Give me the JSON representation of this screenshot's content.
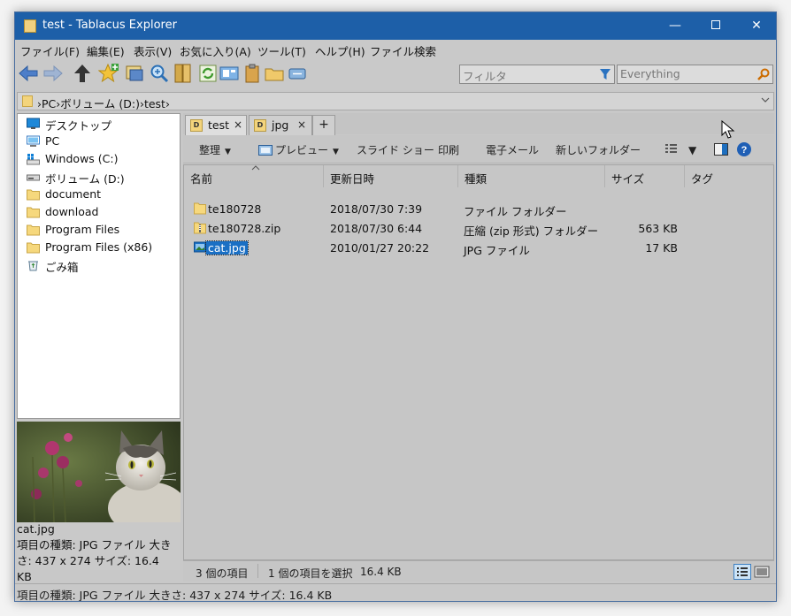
{
  "window": {
    "title": "test - Tablacus Explorer",
    "controls": {
      "minimize": "—",
      "close": "✕"
    }
  },
  "menu": [
    "ファイル(F)",
    "編集(E)",
    "表示(V)",
    "お気に入り(A)",
    "ツール(T)",
    "ヘルプ(H)",
    "ファイル検索"
  ],
  "toolbar": {
    "icons": [
      "back-arrow",
      "forward-arrow",
      "up-arrow",
      "add-favorite",
      "new-window",
      "search",
      "folder-tree",
      "refresh",
      "view",
      "paste",
      "new-folder",
      "properties"
    ],
    "filter_placeholder": "フィルタ",
    "everything_placeholder": "Everything"
  },
  "address": {
    "path": "›PC›ボリューム (D:)›test›"
  },
  "tree": [
    {
      "label": "デスクトップ",
      "icon": "desktop-icon"
    },
    {
      "label": "PC",
      "icon": "pc-icon"
    },
    {
      "label": "Windows (C:)",
      "icon": "windows-drive-icon"
    },
    {
      "label": "ボリューム (D:)",
      "icon": "drive-icon"
    },
    {
      "label": "document",
      "icon": "folder-icon"
    },
    {
      "label": "download",
      "icon": "folder-icon"
    },
    {
      "label": "Program Files",
      "icon": "folder-icon"
    },
    {
      "label": "Program Files (x86)",
      "icon": "folder-icon"
    },
    {
      "label": "ごみ箱",
      "icon": "recycle-bin-icon"
    }
  ],
  "preview": {
    "filename": "cat.jpg",
    "info": "項目の種類: JPG ファイル 大きさ: 437 x 274 サイズ: 16.4 KB"
  },
  "tabs": [
    {
      "label": "test",
      "badge": "D",
      "close": "×",
      "active": true
    },
    {
      "label": "jpg",
      "badge": "D",
      "close": "×",
      "active": false
    }
  ],
  "tab_add": "+",
  "commands": {
    "organize": "整理",
    "preview": "プレビュー",
    "slideshow": "スライド ショー",
    "print": "印刷",
    "email": "電子メール",
    "new_folder": "新しいフォルダー"
  },
  "columns": [
    "名前",
    "更新日時",
    "種類",
    "サイズ",
    "タグ"
  ],
  "files": [
    {
      "name": "te180728",
      "date": "2018/07/30 7:39",
      "type": "ファイル フォルダー",
      "size": "",
      "icon": "folder-icon",
      "selected": false
    },
    {
      "name": "te180728.zip",
      "date": "2018/07/30 6:44",
      "type": "圧縮 (zip 形式) フォルダー",
      "size": "563 KB",
      "icon": "zip-icon",
      "selected": false
    },
    {
      "name": "cat.jpg",
      "date": "2010/01/27 20:22",
      "type": "JPG ファイル",
      "size": "17 KB",
      "icon": "image-icon",
      "selected": true
    }
  ],
  "status": {
    "item_count": "3 個の項目",
    "selection": "1 個の項目を選択",
    "selection_size": "16.4 KB",
    "bottom": "項目の種類: JPG ファイル 大きさ: 437 x 274 サイズ: 16.4 KB"
  }
}
